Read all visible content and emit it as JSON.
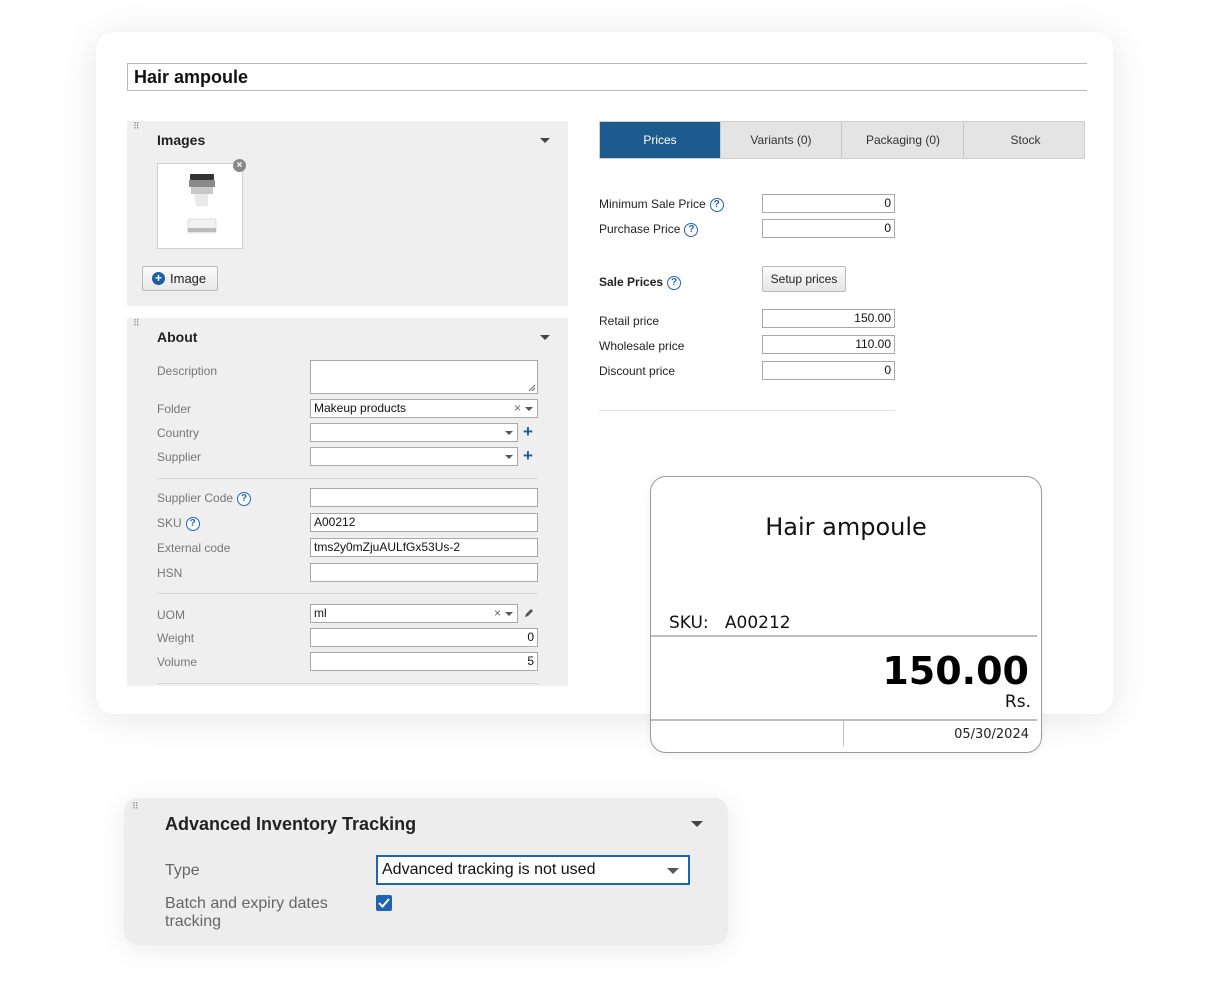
{
  "product_title": "Hair ampoule",
  "images_panel": {
    "title": "Images",
    "add_image_label": "Image"
  },
  "about_panel": {
    "title": "About",
    "description_label": "Description",
    "folder_label": "Folder",
    "folder_value": "Makeup products",
    "country_label": "Country",
    "supplier_label": "Supplier",
    "supplier_code_label": "Supplier Code",
    "sku_label": "SKU",
    "sku_value": "A00212",
    "external_code_label": "External code",
    "external_code_value": "tms2y0mZjuAULfGx53Us-2",
    "hsn_label": "HSN",
    "uom_label": "UOM",
    "uom_value": "ml",
    "weight_label": "Weight",
    "weight_value": "0",
    "volume_label": "Volume",
    "volume_value": "5"
  },
  "tabs": [
    {
      "label": "Prices",
      "active": true
    },
    {
      "label": "Variants (0)",
      "active": false
    },
    {
      "label": "Packaging (0)",
      "active": false
    },
    {
      "label": "Stock",
      "active": false
    }
  ],
  "prices": {
    "min_sale_label": "Minimum Sale Price",
    "min_sale_value": "0",
    "purchase_label": "Purchase Price",
    "purchase_value": "0",
    "sale_prices_label": "Sale Prices",
    "setup_button": "Setup prices",
    "retail_label": "Retail price",
    "retail_value": "150.00",
    "wholesale_label": "Wholesale price",
    "wholesale_value": "110.00",
    "discount_label": "Discount price",
    "discount_value": "0"
  },
  "price_label": {
    "title": "Hair ampoule",
    "sku_prefix": "SKU:",
    "sku": "A00212",
    "price": "150.00",
    "currency": "Rs.",
    "date": "05/30/2024"
  },
  "advanced_tracking": {
    "title": "Advanced Inventory Tracking",
    "type_label": "Type",
    "type_value": "Advanced tracking is not used",
    "batch_label": "Batch and expiry dates tracking",
    "batch_checked": true
  },
  "colors": {
    "accent": "#1d5b8e",
    "link_blue": "#1f63b4",
    "panel_bg": "#efefef"
  }
}
